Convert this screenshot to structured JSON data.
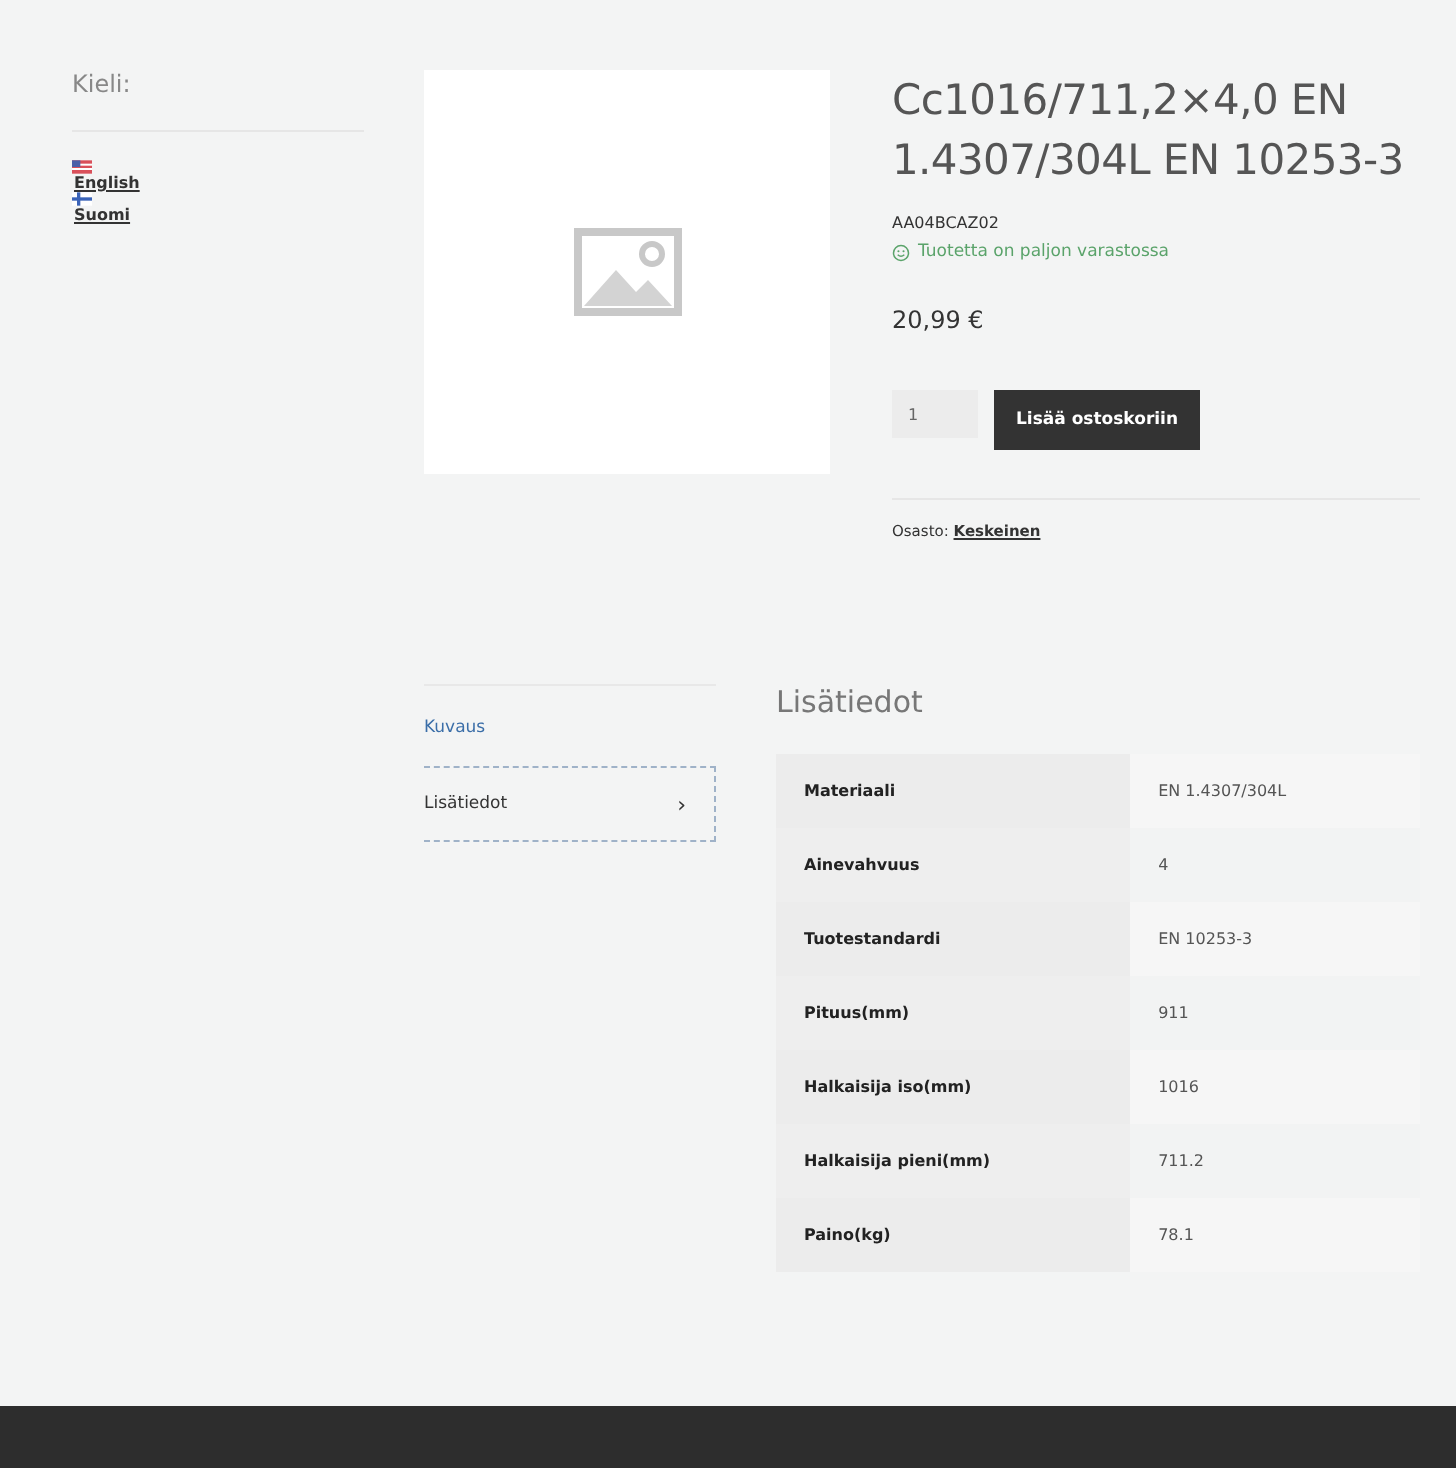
{
  "sidebar": {
    "title": "Kieli:",
    "languages": [
      {
        "label": "English",
        "kind": "us"
      },
      {
        "label": "Suomi",
        "kind": "fi"
      }
    ]
  },
  "product": {
    "title": "Cc1016/711,2×4,0 EN 1.4307/304L EN 10253-3",
    "sku": "AA04BCAZ02",
    "stock": "Tuotetta on paljon varastossa",
    "price": "20,99 €",
    "quantity": "1",
    "add_button": "Lisää ostoskoriin",
    "category_label": "Osasto:",
    "category": "Keskeinen"
  },
  "tabs": [
    {
      "label": "Kuvaus",
      "selected": false
    },
    {
      "label": "Lisätiedot",
      "selected": true,
      "arrow": "›"
    }
  ],
  "section_title": "Lisätiedot",
  "attributes": [
    {
      "name": "Materiaali",
      "value": "EN 1.4307/304L"
    },
    {
      "name": "Ainevahvuus",
      "value": "4"
    },
    {
      "name": "Tuotestandardi",
      "value": "EN 10253-3"
    },
    {
      "name": "Pituus(mm)",
      "value": "911"
    },
    {
      "name": "Halkaisija iso(mm)",
      "value": "1016"
    },
    {
      "name": "Halkaisija pieni(mm)",
      "value": "711.2"
    },
    {
      "name": "Paino(kg)",
      "value": "78.1"
    }
  ]
}
